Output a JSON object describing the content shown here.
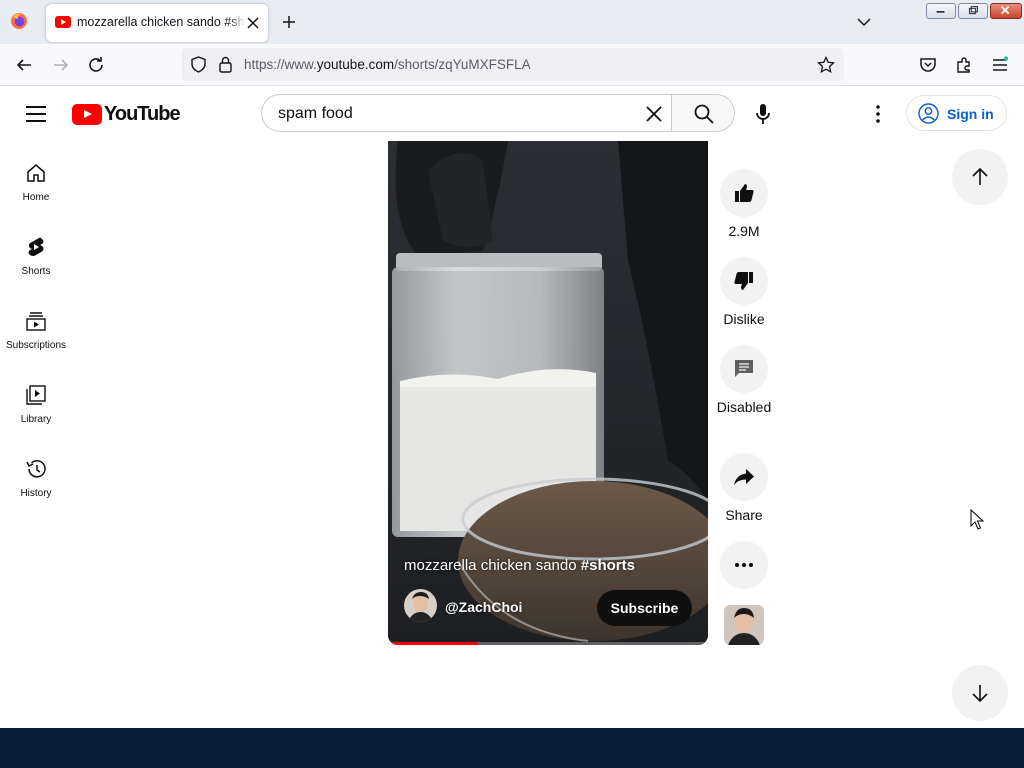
{
  "browser": {
    "tab": {
      "title": "mozzarella chicken sando #shorts - YouTube"
    },
    "url_prefix": "https://www.",
    "url_host": "youtube.com",
    "url_path": "/shorts/zqYuMXFSFLA",
    "icons": [
      "firefox-logo",
      "youtube-favicon",
      "close-icon",
      "plus-icon",
      "chevron-down-icon",
      "back-icon",
      "forward-icon",
      "reload-icon",
      "shield-icon",
      "lock-icon",
      "star-icon",
      "pocket-icon",
      "extensions-icon",
      "menu-icon"
    ]
  },
  "youtube": {
    "logo_text": "YouTube",
    "search": {
      "value": "spam food"
    },
    "signin_label": "Sign in",
    "guide": [
      {
        "label": "Home",
        "icon": "home-icon"
      },
      {
        "label": "Shorts",
        "icon": "shorts-icon"
      },
      {
        "label": "Subscriptions",
        "icon": "subscriptions-icon"
      },
      {
        "label": "Library",
        "icon": "library-icon"
      },
      {
        "label": "History",
        "icon": "history-icon"
      }
    ],
    "short": {
      "title_text": "mozzarella chicken sando ",
      "title_hashtag": "#shorts",
      "channel": "@ZachChoi",
      "subscribe_label": "Subscribe",
      "progress": 0.28
    },
    "actions": {
      "like_count": "2.9M",
      "dislike_label": "Dislike",
      "comments_label": "Disabled",
      "share_label": "Share"
    }
  },
  "colors": {
    "brand_red": "#ff0000",
    "link_blue": "#065fd4",
    "taskbar": "#0a1e3c"
  }
}
